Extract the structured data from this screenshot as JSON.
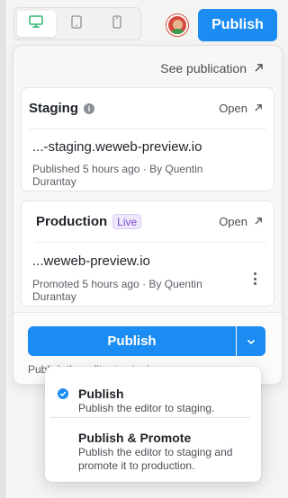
{
  "topbar": {
    "devices": [
      {
        "name": "desktop-icon",
        "active": true
      },
      {
        "name": "tablet-icon",
        "active": false
      },
      {
        "name": "mobile-icon",
        "active": false
      }
    ],
    "publish_label": "Publish"
  },
  "panel": {
    "see_publication": "See publication",
    "staging": {
      "title": "Staging",
      "open_label": "Open",
      "url": "...-staging.weweb-preview.io",
      "meta": "Published 5 hours ago · By Quentin Durantay"
    },
    "production": {
      "title": "Production",
      "badge": "Live",
      "open_label": "Open",
      "url": "...weweb-preview.io",
      "meta": "Promoted 5 hours ago · By Quentin Durantay"
    },
    "publish_button": "Publish",
    "footer_note": "Publish the editor to staging."
  },
  "menu": {
    "items": [
      {
        "title": "Publish",
        "description": "Publish the editor to staging.",
        "selected": true
      },
      {
        "title": "Publish & Promote",
        "description": "Publish the editor to staging and promote it to production.",
        "selected": false
      }
    ]
  },
  "colors": {
    "accent": "#1b8cf2",
    "live_badge": "#7a4fd6",
    "active_device": "#2fb36f"
  }
}
